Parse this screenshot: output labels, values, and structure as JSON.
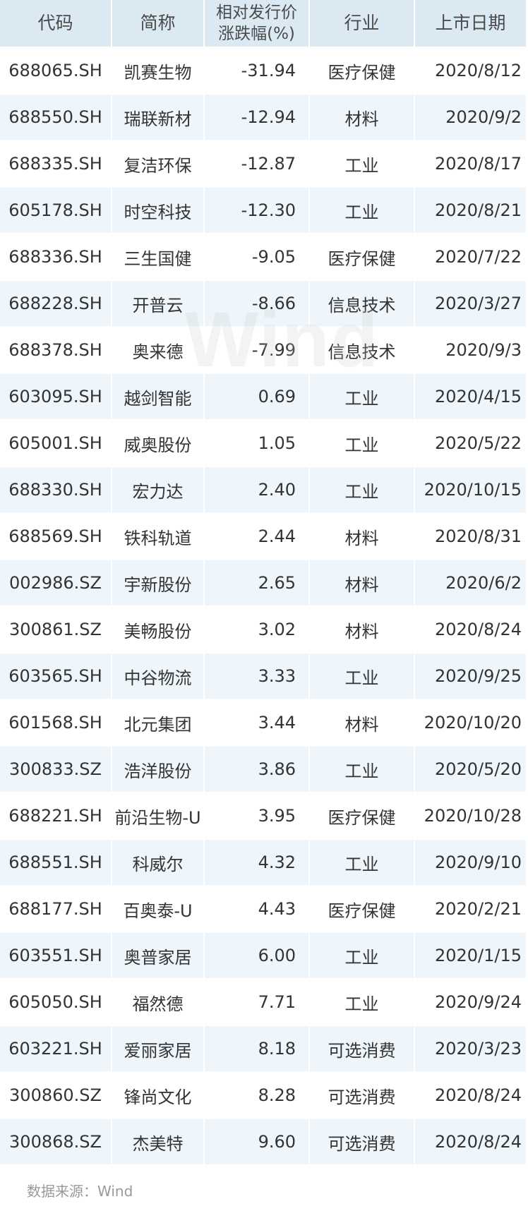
{
  "table": {
    "headers": {
      "code": "代码",
      "name": "简称",
      "change_line1": "相对发行价",
      "change_line2": "涨跌幅(%)",
      "industry": "行业",
      "date": "上市日期"
    },
    "rows": [
      {
        "code": "688065.SH",
        "name": "凯赛生物",
        "change": "-31.94",
        "industry": "医疗保健",
        "date": "2020/8/12"
      },
      {
        "code": "688550.SH",
        "name": "瑞联新材",
        "change": "-12.94",
        "industry": "材料",
        "date": "2020/9/2"
      },
      {
        "code": "688335.SH",
        "name": "复洁环保",
        "change": "-12.87",
        "industry": "工业",
        "date": "2020/8/17"
      },
      {
        "code": "605178.SH",
        "name": "时空科技",
        "change": "-12.30",
        "industry": "工业",
        "date": "2020/8/21"
      },
      {
        "code": "688336.SH",
        "name": "三生国健",
        "change": "-9.05",
        "industry": "医疗保健",
        "date": "2020/7/22"
      },
      {
        "code": "688228.SH",
        "name": "开普云",
        "change": "-8.66",
        "industry": "信息技术",
        "date": "2020/3/27"
      },
      {
        "code": "688378.SH",
        "name": "奥来德",
        "change": "-7.99",
        "industry": "信息技术",
        "date": "2020/9/3"
      },
      {
        "code": "603095.SH",
        "name": "越剑智能",
        "change": "0.69",
        "industry": "工业",
        "date": "2020/4/15"
      },
      {
        "code": "605001.SH",
        "name": "威奥股份",
        "change": "1.05",
        "industry": "工业",
        "date": "2020/5/22"
      },
      {
        "code": "688330.SH",
        "name": "宏力达",
        "change": "2.40",
        "industry": "工业",
        "date": "2020/10/15"
      },
      {
        "code": "688569.SH",
        "name": "铁科轨道",
        "change": "2.44",
        "industry": "材料",
        "date": "2020/8/31"
      },
      {
        "code": "002986.SZ",
        "name": "宇新股份",
        "change": "2.65",
        "industry": "材料",
        "date": "2020/6/2"
      },
      {
        "code": "300861.SZ",
        "name": "美畅股份",
        "change": "3.02",
        "industry": "材料",
        "date": "2020/8/24"
      },
      {
        "code": "603565.SH",
        "name": "中谷物流",
        "change": "3.33",
        "industry": "工业",
        "date": "2020/9/25"
      },
      {
        "code": "601568.SH",
        "name": "北元集团",
        "change": "3.44",
        "industry": "材料",
        "date": "2020/10/20"
      },
      {
        "code": "300833.SZ",
        "name": "浩洋股份",
        "change": "3.86",
        "industry": "工业",
        "date": "2020/5/20"
      },
      {
        "code": "688221.SH",
        "name": "前沿生物-U",
        "change": "3.95",
        "industry": "医疗保健",
        "date": "2020/10/28"
      },
      {
        "code": "688551.SH",
        "name": "科威尔",
        "change": "4.32",
        "industry": "工业",
        "date": "2020/9/10"
      },
      {
        "code": "688177.SH",
        "name": "百奥泰-U",
        "change": "4.43",
        "industry": "医疗保健",
        "date": "2020/2/21"
      },
      {
        "code": "603551.SH",
        "name": "奥普家居",
        "change": "6.00",
        "industry": "工业",
        "date": "2020/1/15"
      },
      {
        "code": "605050.SH",
        "name": "福然德",
        "change": "7.71",
        "industry": "工业",
        "date": "2020/9/24"
      },
      {
        "code": "603221.SH",
        "name": "爱丽家居",
        "change": "8.18",
        "industry": "可选消费",
        "date": "2020/3/23"
      },
      {
        "code": "300860.SZ",
        "name": "锋尚文化",
        "change": "8.28",
        "industry": "可选消费",
        "date": "2020/8/24"
      },
      {
        "code": "300868.SZ",
        "name": "杰美特",
        "change": "9.60",
        "industry": "可选消费",
        "date": "2020/8/24"
      }
    ]
  },
  "watermark": "Wind",
  "source": "数据来源：Wind"
}
